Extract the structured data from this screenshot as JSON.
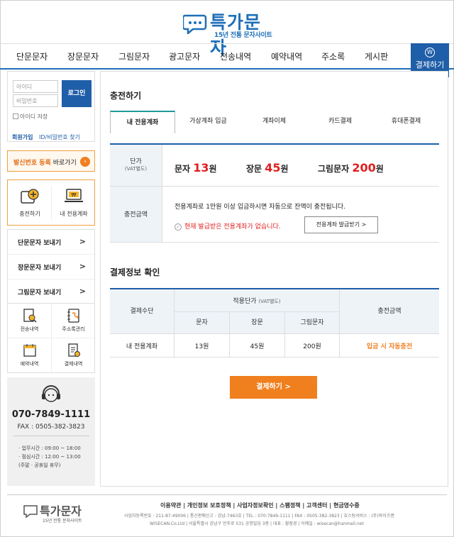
{
  "header": {
    "logo_title": "특가문자",
    "logo_sub": "15년 전통 문자사이트",
    "nav": [
      "단문문자",
      "장문문자",
      "그림문자",
      "광고문자",
      "전송내역",
      "예약내역",
      "주소록",
      "게시판"
    ],
    "pay_button": "결제하기",
    "pay_icon_text": "W"
  },
  "sidebar": {
    "id_placeholder": "아이디",
    "pw_placeholder": "비밀번호",
    "login_button": "로그인",
    "save_id": "아이디 저장",
    "join": "회원가입",
    "find": "ID/비밀번호 찾기",
    "register_bold": "발신번호 등록",
    "register_rest": " 바로가기",
    "charge_label": "충전하기",
    "account_label": "내 전용계좌",
    "send_items": [
      "단문문자 보내기",
      "장문문자 보내기",
      "그림문자 보내기"
    ],
    "grid_items": [
      "전송내역",
      "주소록관리",
      "예약내역",
      "결제내역"
    ],
    "phone": "070-7849-1111",
    "fax": "FAX : 0505-382-3823",
    "hours": [
      "· 업무시간 : 09:00 ~ 18:00",
      "· 점심시간 : 12:00 ~ 13:00",
      "(주말 · 공휴일 휴무)"
    ]
  },
  "main": {
    "charge_title": "충전하기",
    "tabs": [
      "내 전용계좌",
      "가상계좌 입금",
      "계좌이체",
      "카드결제",
      "휴대폰결제"
    ],
    "unit_label": "단가",
    "unit_label_sub": "(VAT별도)",
    "prices": [
      {
        "label": "문자",
        "value": "13",
        "unit": "원"
      },
      {
        "label": "장문",
        "value": "45",
        "unit": "원"
      },
      {
        "label": "그림문자",
        "value": "200",
        "unit": "원"
      }
    ],
    "amount_label": "충전금액",
    "amount_note": "전용계좌로 1만원 이상 입금하시면 자동으로 잔액이 충전됩니다.",
    "amount_warning": "현재 발급받은 전용계좌가 없습니다.",
    "issue_button": "전용계좌 발급받기 >",
    "confirm_title": "결제정보 확인",
    "table": {
      "col_method": "결제수단",
      "col_unit": "적용단가",
      "col_unit_sub": "(VAT별도)",
      "col_amount": "충전금액",
      "sub_cols": [
        "문자",
        "장문",
        "그림문자"
      ],
      "row": {
        "method": "내 전용계좌",
        "sms": "13원",
        "lms": "45원",
        "mms": "200원",
        "amount": "입금 시 자동충전"
      }
    },
    "pay_button": "결제하기  >"
  },
  "footer": {
    "logo_title": "특가문자",
    "logo_sub": "15년 전통 문자사이트",
    "links": "이용약관  |  개인정보 보호정책  |  사업자정보확인  |  스팸정책  |  고객센터  |  현금영수증",
    "info1": "사업자등록번호 : 211-87-49006 | 통신판매신고 : 강남-7463호 | TEL : 070-7849-1111 | FAX : 0505-382-3823 | 호스팅서비스 : (주)와이즈캔",
    "info2": "WISECAN.Co.Ltd | 서울특별시 강남구 언주로 531 공항빌딩 3층 | 대표 : 황점경 | 이메일 : wisecan@hanmail.net"
  },
  "colors": {
    "brand_blue": "#1f5ea8",
    "accent_orange": "#f07f1e",
    "price_red": "#e02020"
  }
}
